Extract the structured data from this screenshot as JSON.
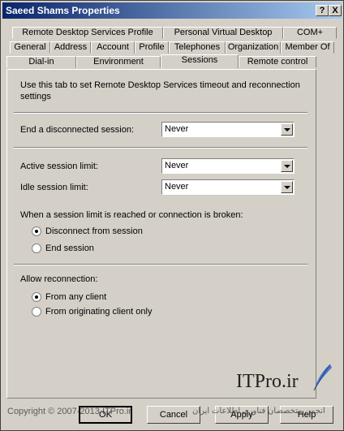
{
  "window": {
    "title": "Saeed Shams Properties",
    "help_btn": "?",
    "close_btn": "X"
  },
  "tabs_row1": [
    "Remote Desktop Services Profile",
    "Personal Virtual Desktop",
    "COM+"
  ],
  "tabs_row2": [
    "General",
    "Address",
    "Account",
    "Profile",
    "Telephones",
    "Organization",
    "Member Of"
  ],
  "tabs_row3": [
    "Dial-in",
    "Environment",
    "Sessions",
    "Remote control"
  ],
  "sessions": {
    "intro": "Use this tab to set Remote Desktop Services timeout and reconnection settings",
    "end_disconnected_label": "End a disconnected session:",
    "end_disconnected_value": "Never",
    "active_limit_label": "Active session limit:",
    "active_limit_value": "Never",
    "idle_limit_label": "Idle session limit:",
    "idle_limit_value": "Never",
    "limit_reached_label": "When a session limit is reached or connection is broken:",
    "disconnect_option": "Disconnect from session",
    "end_option": "End session",
    "allow_reconnect_label": "Allow reconnection:",
    "any_client_option": "From any client",
    "originating_client_option": "From originating client only"
  },
  "buttons": {
    "ok": "OK",
    "cancel": "Cancel",
    "apply": "Apply",
    "help": "Help"
  },
  "watermark": {
    "logo": "ITPro.ir",
    "copyright": "Copyright © 2007-2013 ITPro.ir",
    "persian": "انجمن متخصصان فناوری اطلاعات ایران"
  }
}
